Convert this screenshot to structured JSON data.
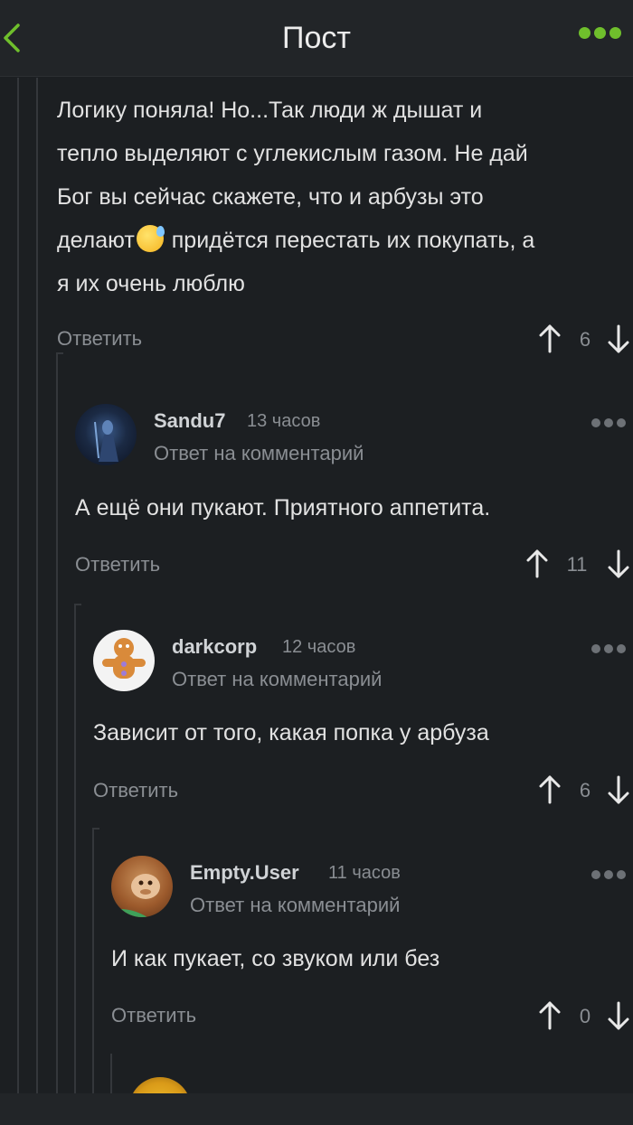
{
  "header": {
    "title": "Пост"
  },
  "comments": [
    {
      "text": "Логику поняла! Но...Так люди ж дышат и\nтепло выделяют с углекислым газом. Не дай\nБог вы сейчас скажете, что и арбузы это\nделают",
      "text_after_emoji": " придётся перестать их покупать, а\nя их очень люблю",
      "emoji": "sweat-smile-emoji",
      "reply_label": "Ответить",
      "votes": "6"
    },
    {
      "author": "Sandu7",
      "time": "13 часов",
      "reply_to": "Ответ на комментарий",
      "text": "А ещё они пукают. Приятного аппетита.",
      "reply_label": "Ответить",
      "votes": "11"
    },
    {
      "author": "darkcorp",
      "time": "12 часов",
      "reply_to": "Ответ на комментарий",
      "text": "Зависит от того, какая попка у арбуза",
      "reply_label": "Ответить",
      "votes": "6"
    },
    {
      "author": "Empty.User",
      "time": "11 часов",
      "reply_to": "Ответ на комментарий",
      "text": "И как пукает, со звуком или без",
      "reply_label": "Ответить",
      "votes": "0"
    }
  ],
  "colors": {
    "accent": "#6fbf2c",
    "background": "#1c1f22",
    "muted": "#8a8e93"
  }
}
